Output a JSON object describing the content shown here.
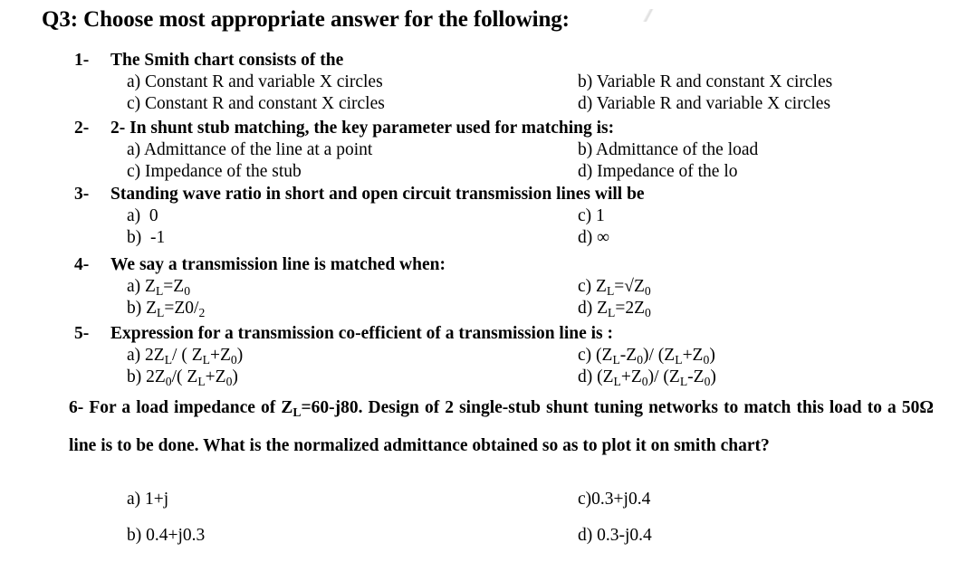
{
  "document": {
    "title": "Q3: Choose most appropriate answer for the following:",
    "questions": [
      {
        "number": "1-",
        "text": "The Smith chart consists of the",
        "options": {
          "a": "a) Constant R and variable X circles",
          "b": "b) Variable R and constant X circles",
          "c": "c) Constant R and constant X circles",
          "d": "d) Variable R and variable X circles"
        }
      },
      {
        "number": "2-",
        "text": "2- In shunt stub matching, the key parameter used for matching is:",
        "options": {
          "a": "a) Admittance of the line at a point",
          "b": "b) Admittance of the load",
          "c": "c) Impedance of the stub",
          "d": "d) Impedance of the lo"
        }
      },
      {
        "number": "3-",
        "text": "Standing wave ratio in short and open circuit transmission lines will be",
        "options": {
          "a_label": "a)",
          "a_value": "0",
          "b_label": "b)",
          "b_value": "-1",
          "c_label": "c)",
          "c_value": "1",
          "d_label": "d)",
          "d_value": "∞"
        }
      },
      {
        "number": "4-",
        "text": "We say a transmission line is matched when:",
        "options": {
          "a": "a) Z",
          "b": "b) Z",
          "c": "c) Z",
          "d": "d) Z"
        }
      },
      {
        "number": "5-",
        "text": "Expression for a transmission co-efficient of a transmission line is :",
        "options": {}
      }
    ],
    "q4_options": {
      "a": {
        "prefix": "a) Z",
        "sub1": "L",
        "mid": "=Z",
        "sub2": "0",
        "suffix": ""
      },
      "b": {
        "prefix": "b) Z",
        "sub1": "L",
        "mid": "=Z0/",
        "sub2": "2",
        "suffix": ""
      },
      "c": {
        "prefix": "c) Z",
        "sub1": "L",
        "mid": "=√Z",
        "sub2": "0",
        "suffix": ""
      },
      "d": {
        "prefix": "d) Z",
        "sub1": "L",
        "mid": "=2Z",
        "sub2": "0",
        "suffix": ""
      }
    },
    "q5_options": {
      "a": "a) 2Z_L/ ( Z_L+Z_0)",
      "b": "b) 2Z_0/( Z_L+Z_0)",
      "c": "c) (Z_L-Z_0)/ (Z_L+Z_0)",
      "d": "d) (Z_L+Z_0)/ (Z_L-Z_0)"
    },
    "q6": {
      "number": "6-",
      "line1_a": "6- For a load impedance of Z",
      "line1_sub": "L",
      "line1_b": "=60-j80. Design of 2 single-stub shunt tuning networks to match this",
      "line2": "load to a 50Ω line is to be done. What is the normalized admittance obtained so as to plot it on smith",
      "line3": "chart?",
      "options": {
        "a": "a) 1+j",
        "b": "b) 0.4+j0.3",
        "c": "c)0.3+j0.4",
        "d": "d) 0.3-j0.4"
      }
    }
  }
}
